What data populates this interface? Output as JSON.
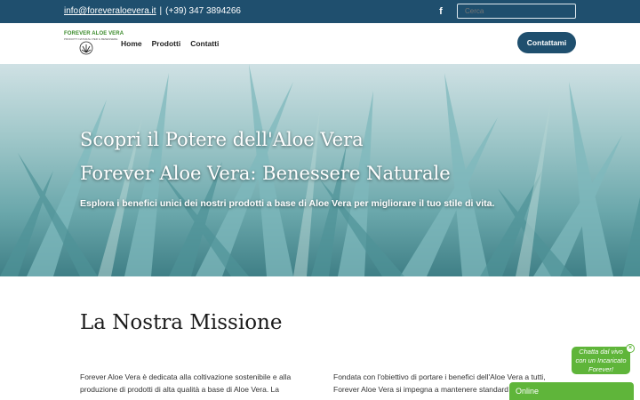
{
  "topbar": {
    "email": "info@foreveraloevera.it",
    "separator": "|",
    "phone": "(+39) 347 3894266",
    "facebook_icon": "facebook-icon",
    "search_placeholder": "Cerca"
  },
  "header": {
    "logo_title": "FOREVER ALOE VERA",
    "logo_subtitle": "PRODOTTI NATURALI PER IL BENESSERE",
    "nav": [
      "Home",
      "Prodotti",
      "Contatti"
    ],
    "cta_label": "Contattami"
  },
  "hero": {
    "title_line1": "Scopri il Potere dell'Aloe Vera",
    "title_line2": "Forever Aloe Vera: Benessere Naturale",
    "subtitle": "Esplora i benefici unici dei nostri prodotti a base di Aloe Vera per migliorare il tuo stile di vita."
  },
  "mission": {
    "title": "La Nostra Missione",
    "col1_text": "Forever Aloe Vera è dedicata alla coltivazione sostenibile e alla produzione di prodotti di alta qualità a base di Aloe Vera. La",
    "col2_text": "Fondata con l'obiettivo di portare i benefici dell'Aloe Vera a tutti, Forever Aloe Vera si impegna a mantenere standard"
  },
  "chat": {
    "bubble_line1": "Chatta dal vivo",
    "bubble_line2": "con un Incaricato",
    "bubble_line3": "Forever!",
    "close_label": "×",
    "status": "Online"
  },
  "colors": {
    "primary": "#1f4f6e",
    "chat_green": "#5fb53a"
  }
}
